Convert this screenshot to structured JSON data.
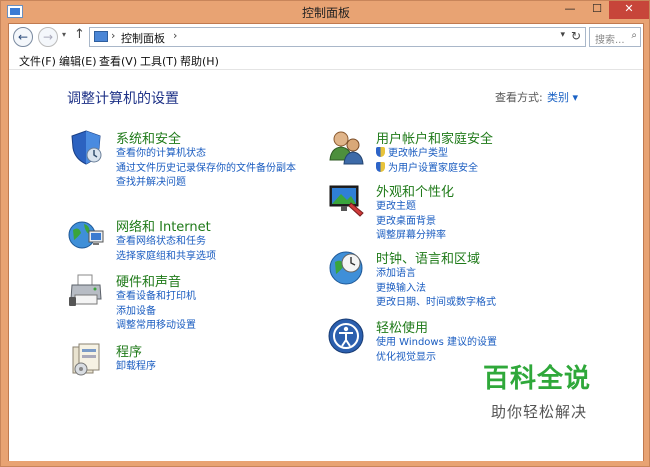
{
  "window": {
    "title": "控制面板",
    "min_label": "—",
    "max_label": "☐",
    "close_label": "✕"
  },
  "address": {
    "path_label": "控制面板",
    "search_placeholder": "搜索..."
  },
  "menu": [
    "文件(F)",
    "编辑(E)",
    "查看(V)",
    "工具(T)",
    "帮助(H)"
  ],
  "main": {
    "title": "调整计算机的设置",
    "view_by_label": "查看方式:",
    "view_by_value": "类别 ▾"
  },
  "categories": [
    {
      "title": "系统和安全",
      "icon": "shield-icon",
      "links": [
        "查看你的计算机状态",
        "通过文件历史记录保存你的文件备份副本",
        "查找并解决问题"
      ]
    },
    {
      "title": "网络和 Internet",
      "icon": "network-icon",
      "links": [
        "查看网络状态和任务",
        "选择家庭组和共享选项"
      ]
    },
    {
      "title": "硬件和声音",
      "icon": "printer-icon",
      "links": [
        "查看设备和打印机",
        "添加设备",
        "调整常用移动设置"
      ]
    },
    {
      "title": "程序",
      "icon": "programs-icon",
      "links": [
        "卸载程序"
      ]
    },
    {
      "title": "用户帐户和家庭安全",
      "icon": "users-icon",
      "links": [
        "更改帐户类型",
        "为用户设置家庭安全"
      ]
    },
    {
      "title": "外观和个性化",
      "icon": "display-icon",
      "links": [
        "更改主题",
        "更改桌面背景",
        "调整屏幕分辨率"
      ]
    },
    {
      "title": "时钟、语言和区域",
      "icon": "clock-globe-icon",
      "links": [
        "添加语言",
        "更换输入法",
        "更改日期、时间或数字格式"
      ]
    },
    {
      "title": "轻松使用",
      "icon": "ease-of-access-icon",
      "links": [
        "使用 Windows 建议的设置",
        "优化视觉显示"
      ]
    }
  ],
  "watermark": {
    "main": "百科全说",
    "sub": "助你轻松解决"
  },
  "colors": {
    "titlebar": "#e8a373",
    "category_title": "#1f7a19",
    "link": "#1a5cc0",
    "page_title": "#1e3287",
    "close_button": "#c7453a",
    "watermark": "#2fa83a"
  }
}
